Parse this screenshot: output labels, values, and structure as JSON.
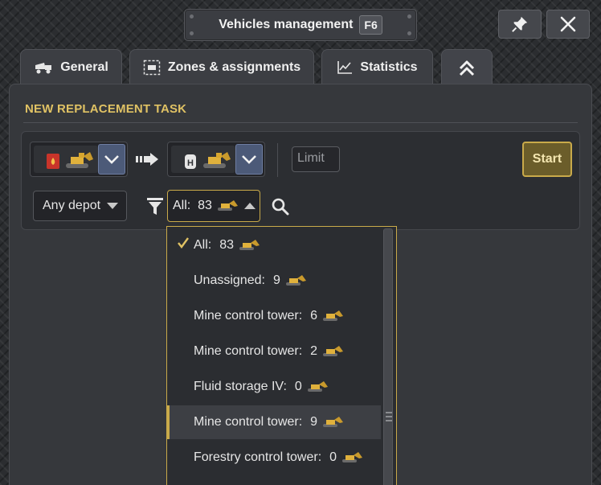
{
  "window": {
    "title": "Vehicles management",
    "hotkey": "F6"
  },
  "tabs": [
    {
      "label": "General",
      "icon": "truck-icon"
    },
    {
      "label": "Zones & assignments",
      "icon": "zone-icon"
    },
    {
      "label": "Statistics",
      "icon": "chart-icon"
    },
    {
      "label": "",
      "icon": "double-chevron-up-icon"
    }
  ],
  "task": {
    "title": "NEW REPLACEMENT TASK",
    "limit_placeholder": "Limit",
    "start_label": "Start",
    "depot_label": "Any depot",
    "filter_value": "All:  83"
  },
  "dropdown": {
    "items": [
      {
        "label": "All:",
        "count": "83",
        "checked": true,
        "hover": false
      },
      {
        "label": "Unassigned:",
        "count": "9",
        "checked": false,
        "hover": false
      },
      {
        "label": "Mine control tower:",
        "count": "6",
        "checked": false,
        "hover": false
      },
      {
        "label": "Mine control tower:",
        "count": "2",
        "checked": false,
        "hover": false
      },
      {
        "label": "Fluid storage IV:",
        "count": "0",
        "checked": false,
        "hover": false
      },
      {
        "label": "Mine control tower:",
        "count": "9",
        "checked": false,
        "hover": true
      },
      {
        "label": "Forestry control tower:",
        "count": "0",
        "checked": false,
        "hover": false
      }
    ]
  },
  "colors": {
    "accent_gold": "#c9aa4a",
    "title_gold": "#e0c264",
    "dropdown_blue": "#4c5a78"
  }
}
